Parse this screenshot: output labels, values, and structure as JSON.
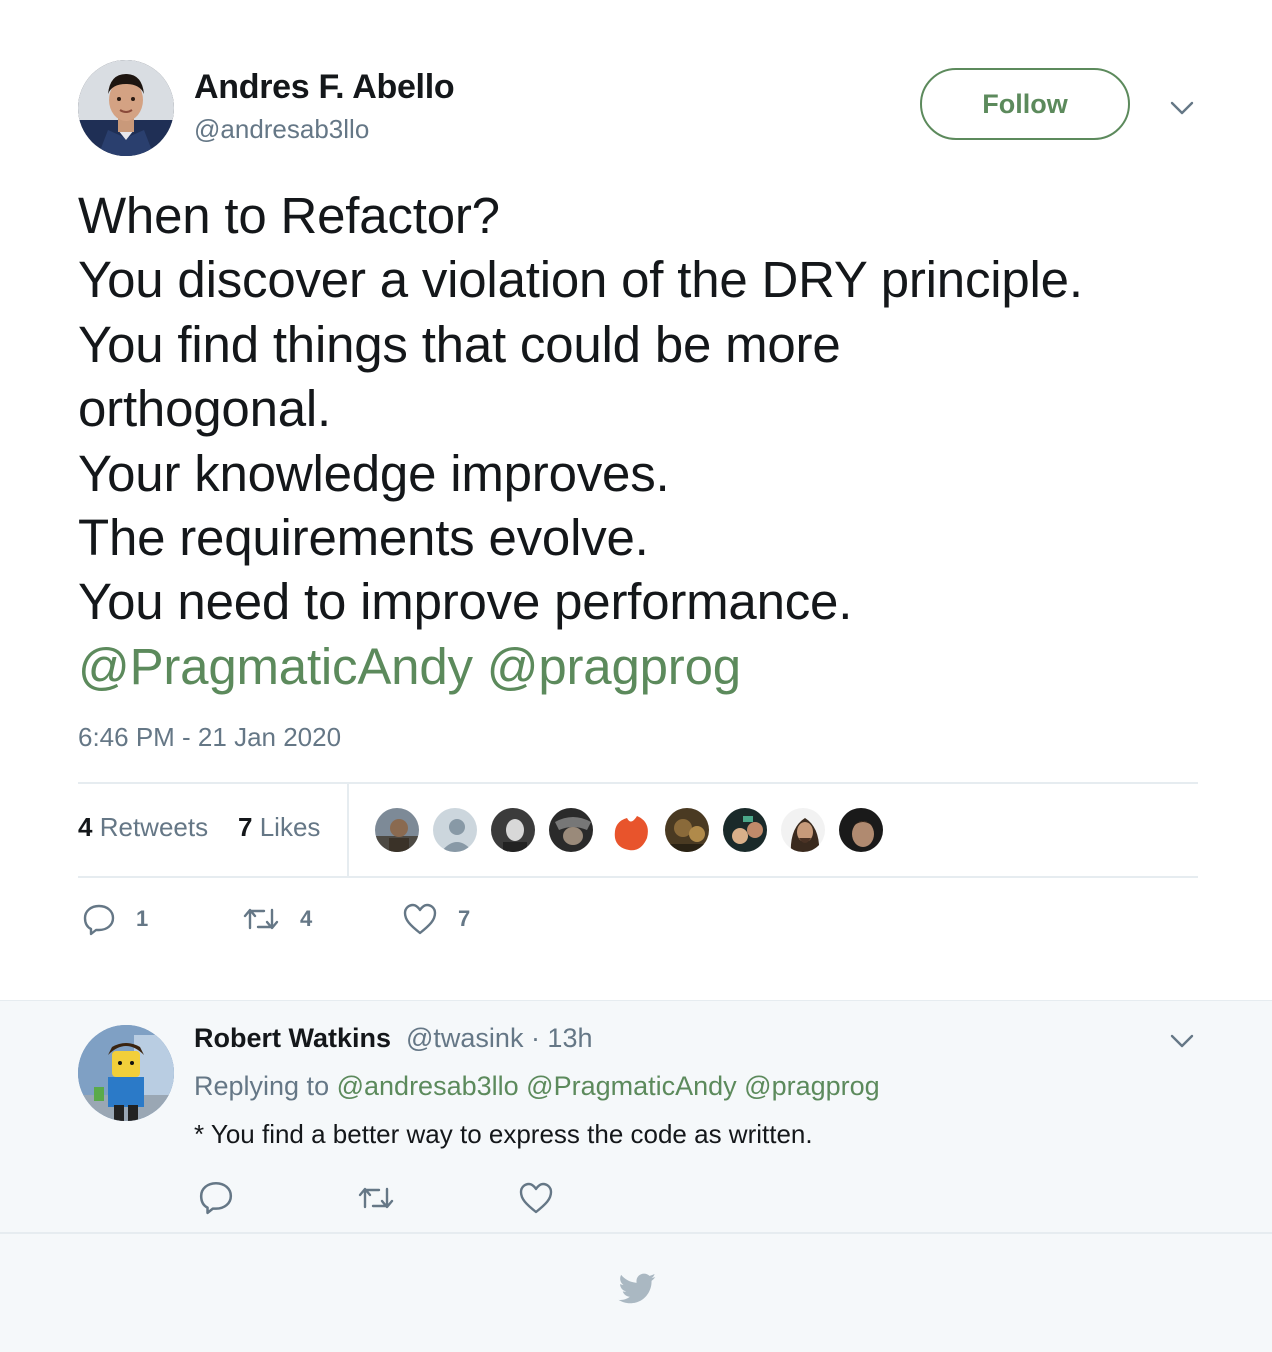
{
  "author": {
    "name": "Andres F. Abello",
    "handle": "@andresab3llo"
  },
  "follow_label": "Follow",
  "tweet": {
    "lines": [
      "When to Refactor?",
      "You discover a violation of the DRY principle.",
      "You find things that could be more",
      "orthogonal.",
      "Your knowledge improves.",
      "The requirements evolve.",
      "You need to improve performance."
    ],
    "mentions": [
      "@PragmaticAndy",
      "@pragprog"
    ],
    "timestamp": "6:46 PM - 21 Jan 2020"
  },
  "stats": {
    "retweets_count": "4",
    "retweets_label": "Retweets",
    "likes_count": "7",
    "likes_label": "Likes"
  },
  "actions": {
    "reply_count": "1",
    "retweet_count": "4",
    "like_count": "7"
  },
  "reply": {
    "name": "Robert Watkins",
    "meta": "@twasink · 13h",
    "replying_prefix": "Replying to",
    "replying_mentions": [
      "@andresab3llo",
      "@PragmaticAndy",
      "@pragprog"
    ],
    "text": "* You find a better way to express the code as written."
  },
  "colors": {
    "accent": "#5c8a5c",
    "secondary_text": "#657786",
    "primary_text": "#14171a",
    "reply_background": "#f5f8fa"
  },
  "icons": {
    "menu": "chevron-down-icon",
    "reply": "speech-bubble-icon",
    "retweet": "retweet-icon",
    "like": "heart-icon",
    "footer": "bird-logo-icon"
  }
}
